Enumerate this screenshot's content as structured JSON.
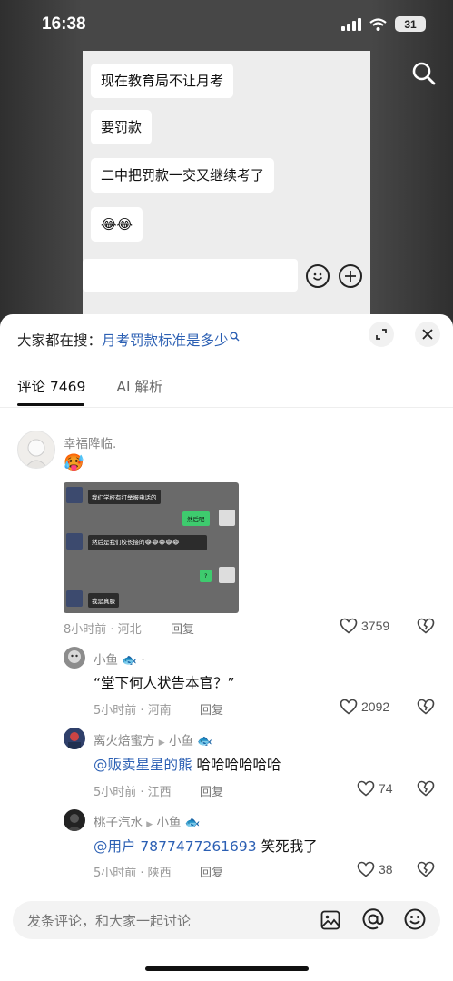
{
  "status": {
    "time": "16:38",
    "battery": "31"
  },
  "video": {
    "messages": [
      "现在教育局不让月考",
      "要罚款",
      "二中把罚款一交又继续考了",
      "😂😂"
    ]
  },
  "sheet": {
    "suggest_prefix": "大家都在搜：",
    "suggest_keyword": "月考罚款标准是多少",
    "tabs": {
      "comments": "评论 7469",
      "ai": "AI 解析"
    }
  },
  "comments": [
    {
      "user": "幸福降临.",
      "emoji": "🥵",
      "image_chat": {
        "msg1": "我们学校有打举报电话的",
        "reply1": "然后呢",
        "msg2": "然后是我们校长接的😂😂😂😂😂",
        "reply2": "?",
        "msg3": "我是真服"
      },
      "time": "8小时前 · 河北",
      "reply": "回复",
      "likes": "3759"
    }
  ],
  "replies": [
    {
      "user": "小鱼",
      "suffix": "·",
      "text": "“堂下何人状告本官？”",
      "time": "5小时前 · 河南",
      "reply": "回复",
      "likes": "2092"
    },
    {
      "user": "离火焙蜜方",
      "to": "小鱼",
      "mention": "@贩卖星星的熊",
      "text": " 哈哈哈哈哈哈",
      "time": "5小时前 · 江西",
      "reply": "回复",
      "likes": "74"
    },
    {
      "user": "桃子汽水",
      "to": "小鱼",
      "mention": "@用户 7877477261693",
      "text": " 笑死我了",
      "time": "5小时前 · 陕西",
      "reply": "回复",
      "likes": "38"
    }
  ],
  "input": {
    "placeholder": "发条评论，和大家一起讨论"
  },
  "colors": {
    "link": "#2b5fb3",
    "text": "#111111",
    "muted": "#999999"
  }
}
